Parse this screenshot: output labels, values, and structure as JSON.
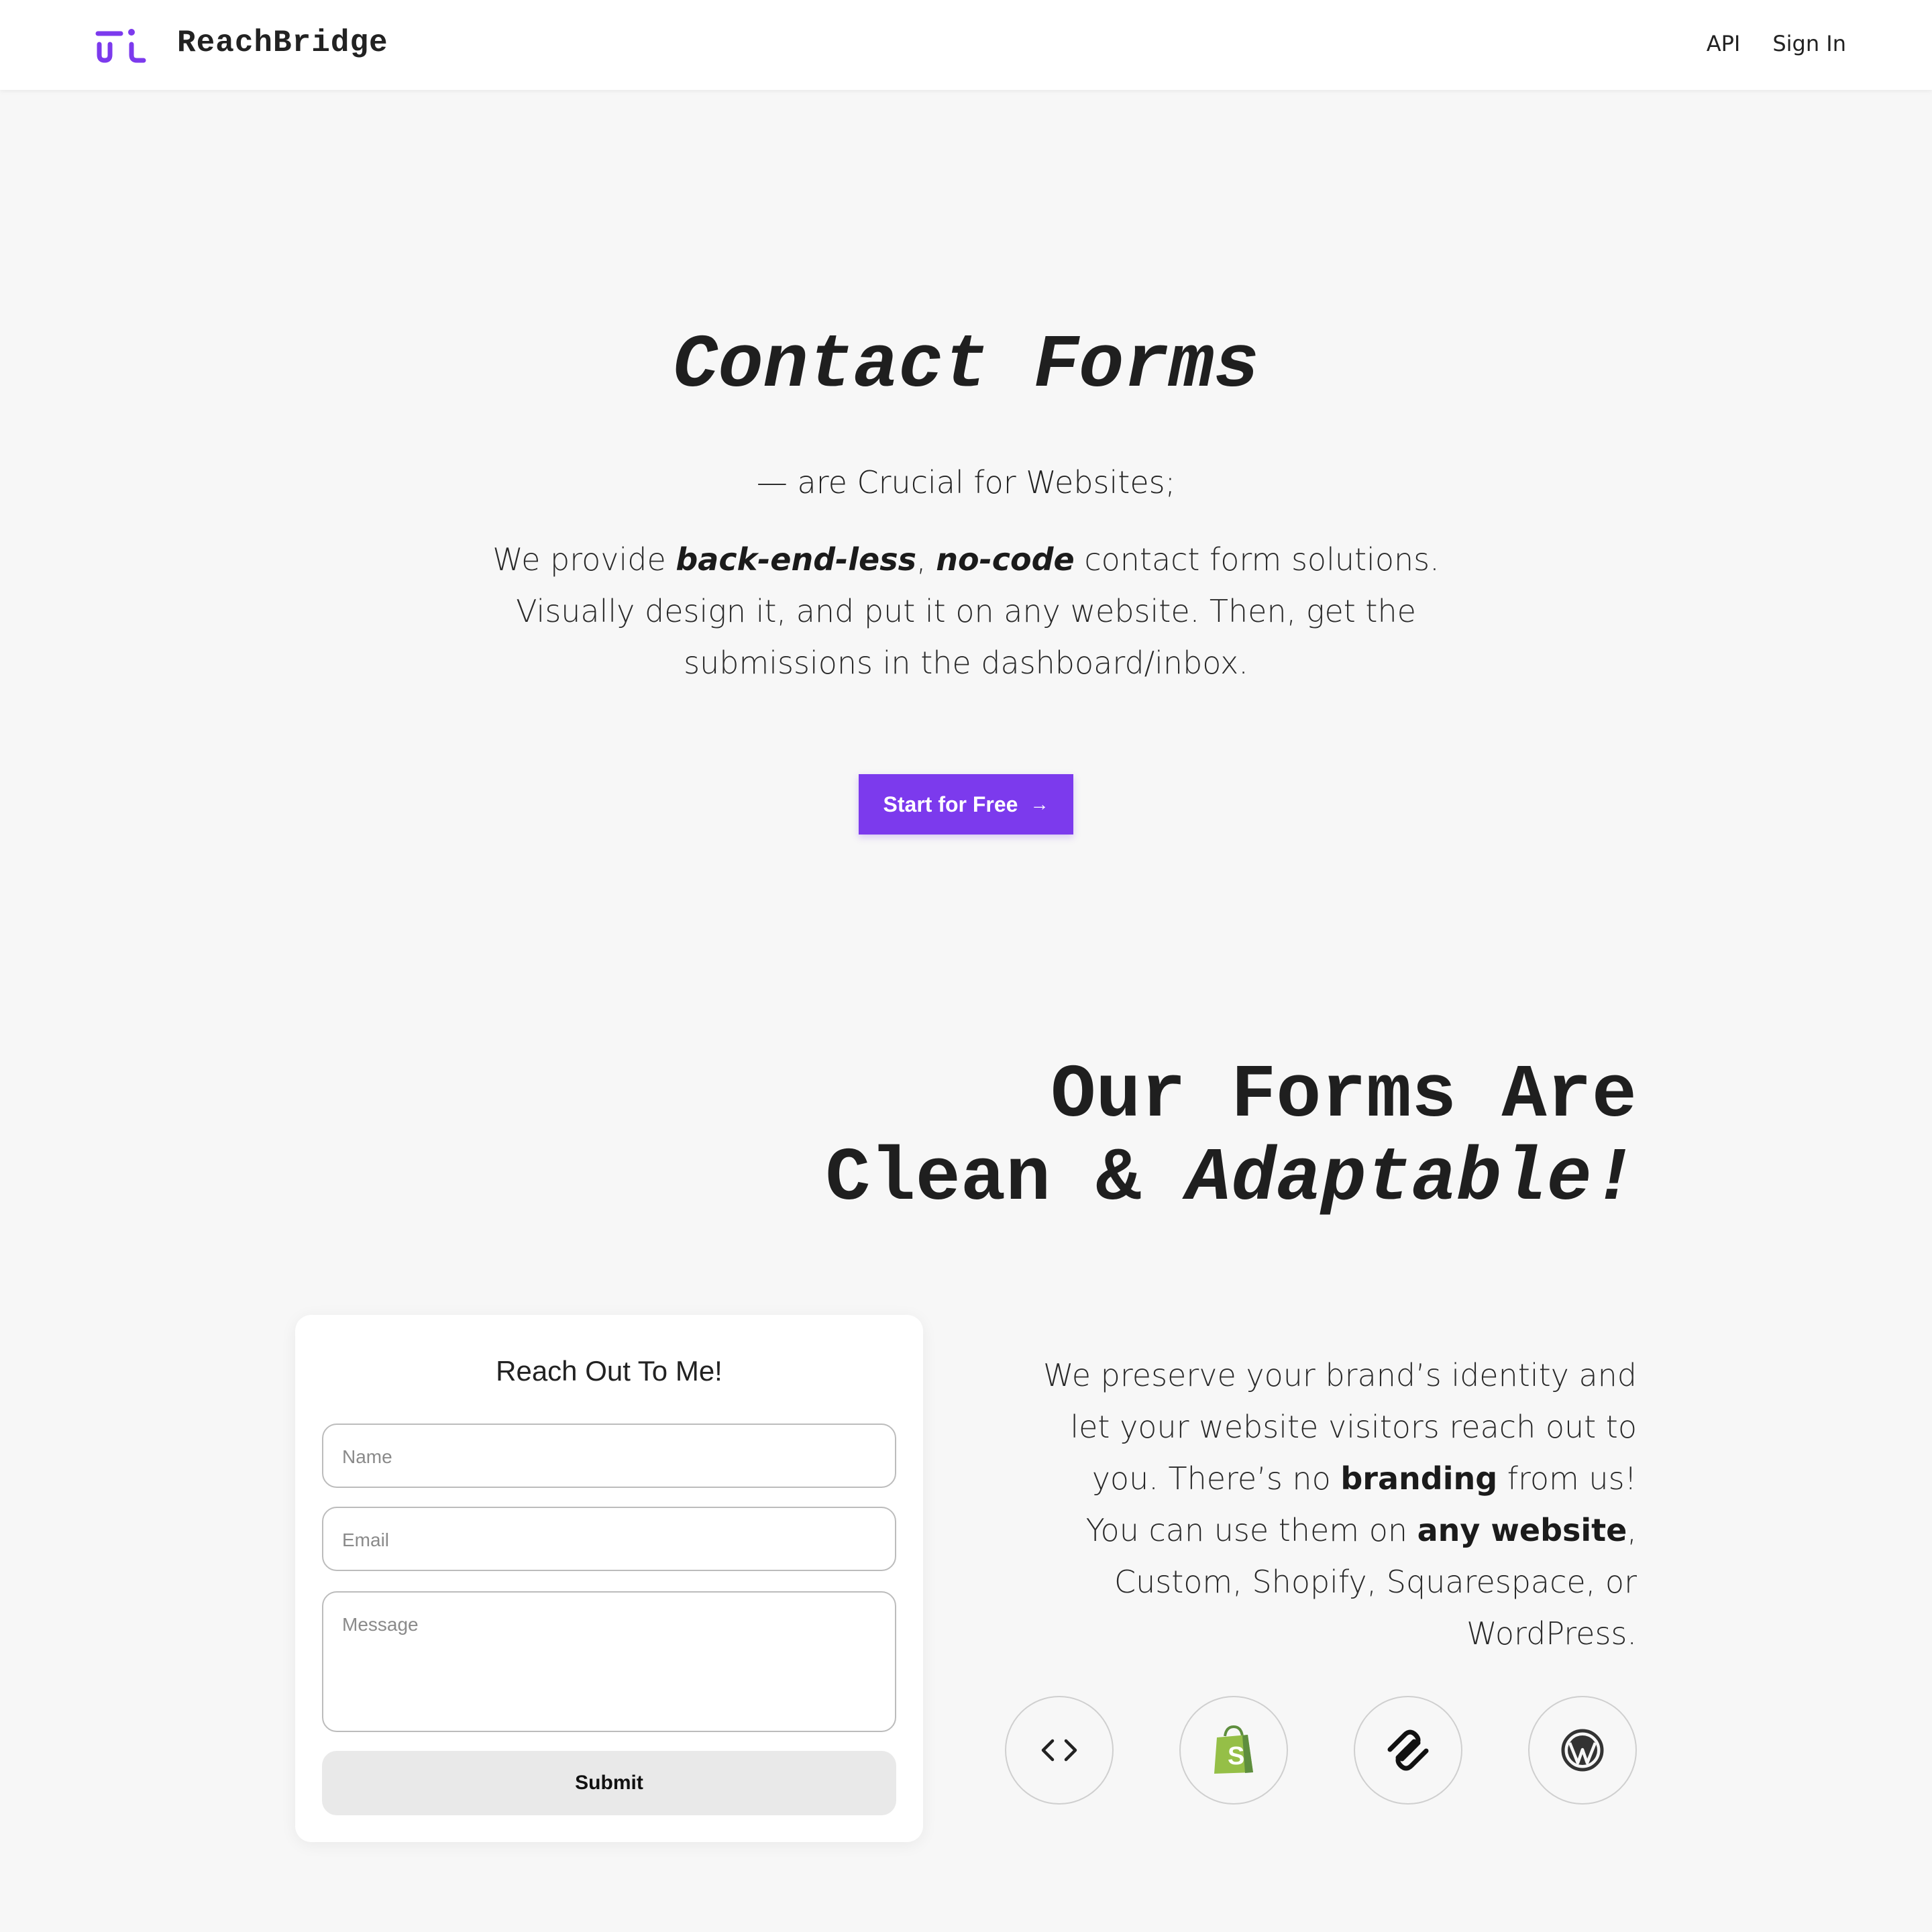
{
  "nav": {
    "brand": "ReachBridge",
    "links": [
      {
        "label": "API"
      },
      {
        "label": "Sign In"
      }
    ]
  },
  "hero": {
    "title": "Contact Forms",
    "subtitle": "— are Crucial for Websites;",
    "desc": {
      "pre": "We provide ",
      "em1": "back-end-less",
      "sep": ", ",
      "em2": "no-code",
      "post": " contact form solutions. Visually design it, and put it on any website. Then, get the submissions in the dashboard/inbox."
    },
    "cta_label": "Start for Free",
    "cta_arrow": "→"
  },
  "section": {
    "title_line1": "Our Forms Are",
    "title_line2_plain": "Clean & ",
    "title_line2_italic": "Adaptable!",
    "text": {
      "p1": "We preserve your brand’s identity and let your website visitors reach out to you. There’s no ",
      "b1": "branding",
      "p2": " from us! You can use them on ",
      "b2": "any website",
      "p3": ", Custom, Shopify, Squarespace, or WordPress."
    }
  },
  "form": {
    "title": "Reach Out To Me!",
    "name_placeholder": "Name",
    "email_placeholder": "Email",
    "message_placeholder": "Message",
    "submit_label": "Submit"
  },
  "platforms": [
    {
      "icon": "code-icon"
    },
    {
      "icon": "shopify-icon"
    },
    {
      "icon": "squarespace-icon"
    },
    {
      "icon": "wordpress-icon"
    }
  ],
  "colors": {
    "accent": "#7c3aed",
    "background": "#f7f7f7",
    "shopify_green": "#95bf47"
  }
}
